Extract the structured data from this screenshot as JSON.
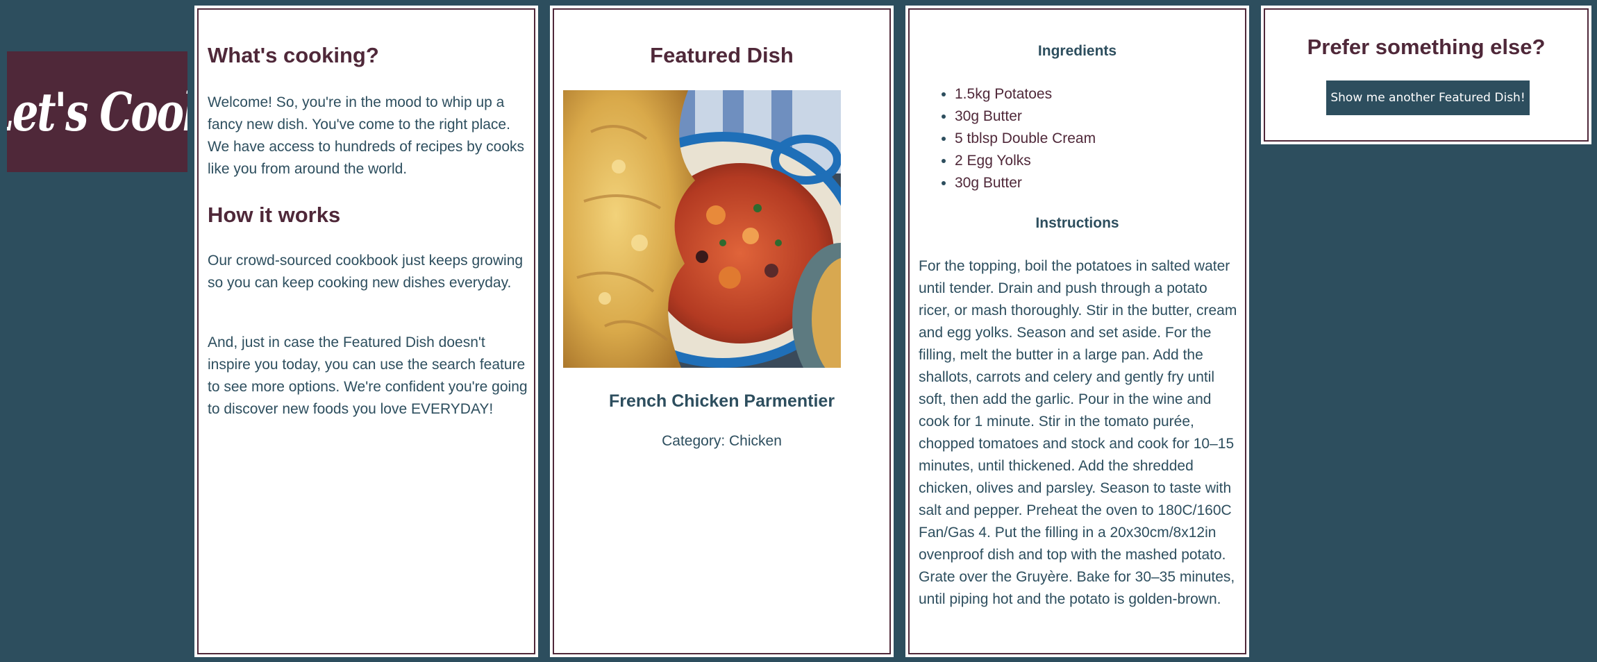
{
  "logo": {
    "text": "Let's Cook"
  },
  "intro": {
    "title": "What's cooking?",
    "paragraph": "Welcome! So, you're in the mood to whip up a fancy new dish. You've come to the right place. We have access to hundreds of recipes by cooks like you from around the world.",
    "how_title": "How it works",
    "how_paragraph_1": "Our crowd-sourced cookbook just keeps growing so you can keep cooking new dishes everyday.",
    "how_paragraph_2": "And, just in case the Featured Dish doesn't inspire you today, you can use the search feature to see more options. We're confident you're going to discover new foods you love EVERYDAY!"
  },
  "featured": {
    "title": "Featured Dish",
    "dish_name": "French Chicken Parmentier",
    "category": "Category: Chicken"
  },
  "recipe": {
    "ingredients_title": "Ingredients",
    "ingredients": [
      "1.5kg Potatoes",
      "30g Butter",
      "5 tblsp Double Cream",
      "2 Egg Yolks",
      "30g Butter"
    ],
    "instructions_title": "Instructions",
    "instructions": "For the topping, boil the potatoes in salted water until tender. Drain and push through a potato ricer, or mash thoroughly. Stir in the butter, cream and egg yolks. Season and set aside. For the filling, melt the butter in a large pan. Add the shallots, carrots and celery and gently fry until soft, then add the garlic. Pour in the wine and cook for 1 minute. Stir in the tomato purée, chopped tomatoes and stock and cook for 10–15 minutes, until thickened. Add the shredded chicken, olives and parsley. Season to taste with salt and pepper. Preheat the oven to 180C/160C Fan/Gas 4. Put the filling in a 20x30cm/8x12in ovenproof dish and top with the mashed potato. Grate over the Gruyère. Bake for 30–35 minutes, until piping hot and the potato is golden-brown."
  },
  "alternative": {
    "title": "Prefer something else?",
    "button_label": "Show me another Featured Dish!"
  },
  "colors": {
    "background": "#2d4e5e",
    "accent": "#4f2839",
    "card": "#ffffff"
  }
}
